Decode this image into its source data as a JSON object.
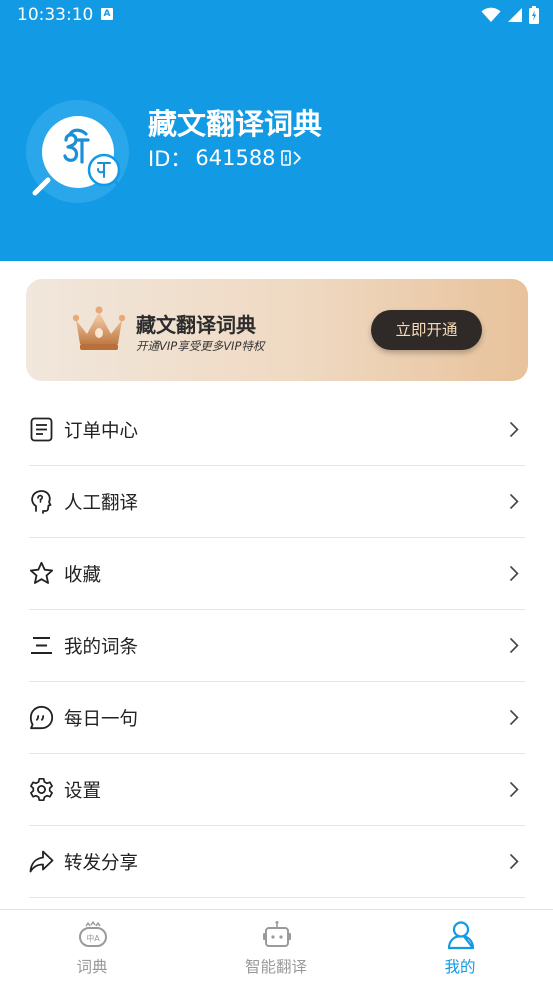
{
  "status_bar": {
    "time": "10:33:10",
    "notification_badge": "A"
  },
  "profile": {
    "app_title": "藏文翻译词典",
    "id_label": "ID：",
    "id_value": "641588"
  },
  "vip_card": {
    "title": "藏文翻译词典",
    "subtitle": "开通VIP享受更多VIP特权",
    "button_label": "立即开通"
  },
  "menu": {
    "items": [
      {
        "label": "订单中心",
        "icon": "order-list-icon"
      },
      {
        "label": "人工翻译",
        "icon": "human-head-icon"
      },
      {
        "label": "收藏",
        "icon": "star-icon"
      },
      {
        "label": "我的词条",
        "icon": "entries-lines-icon"
      },
      {
        "label": "每日一句",
        "icon": "quote-bubble-icon"
      },
      {
        "label": "设置",
        "icon": "gear-icon"
      },
      {
        "label": "转发分享",
        "icon": "share-arrow-icon"
      }
    ]
  },
  "tabbar": {
    "tabs": [
      {
        "label": "词典",
        "icon": "dictionary-icon",
        "active": false
      },
      {
        "label": "智能翻译",
        "icon": "robot-icon",
        "active": false
      },
      {
        "label": "我的",
        "icon": "person-icon",
        "active": true
      }
    ]
  },
  "colors": {
    "primary": "#129ae4",
    "vip_button_bg": "#2f2a27",
    "vip_button_text": "#f5d9b8",
    "tab_inactive": "#9a9a9a"
  }
}
